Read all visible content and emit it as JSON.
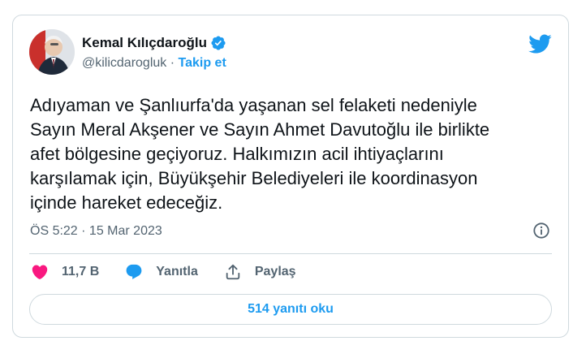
{
  "author": {
    "name": "Kemal Kılıçdaroğlu",
    "handle": "@kilicdarogluk",
    "separator": " · ",
    "follow_label": "Takip et"
  },
  "tweet": {
    "text": "Adıyaman ve Şanlıurfa'da yaşanan sel felaketi nedeniyle\nSayın Meral Akşener ve Sayın Ahmet Davutoğlu ile birlikte\nafet bölgesine geçiyoruz. Halkımızın acil ihtiyaçlarını\nkarşılamak için, Büyükşehir Belediyeleri ile koordinasyon\niçinde hareket edeceğiz.",
    "timestamp": "ÖS 5:22 · 15 Mar 2023"
  },
  "actions": {
    "like_count": "11,7 B",
    "reply_label": "Yanıtla",
    "share_label": "Paylaş"
  },
  "replies_button_label": "514 yanıtı oku",
  "icons": {
    "verified": "verified-badge-icon",
    "brand": "twitter-bird-icon",
    "info": "info-icon",
    "like": "heart-icon",
    "reply": "reply-bubble-icon",
    "share": "share-upload-icon"
  },
  "colors": {
    "accent": "#1d9bf0",
    "like": "#f91880",
    "text": "#0f1419",
    "secondary": "#536471",
    "border": "#cfd9de"
  }
}
